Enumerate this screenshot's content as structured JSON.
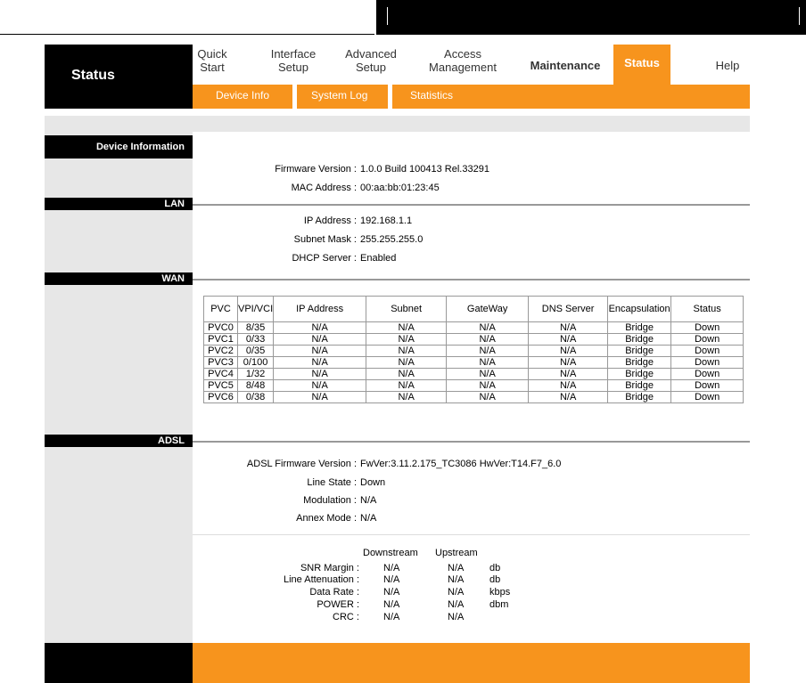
{
  "header": {
    "title": "Status",
    "nav": [
      {
        "label1": "Quick",
        "label2": "Start"
      },
      {
        "label1": "Interface",
        "label2": "Setup"
      },
      {
        "label1": "Advanced",
        "label2": "Setup"
      },
      {
        "label1": "Access",
        "label2": "Management"
      },
      {
        "label1": "Maintenance"
      },
      {
        "label1": "Status"
      },
      {
        "label1": "Help"
      }
    ],
    "subnav": [
      "Device Info",
      "System Log",
      "Statistics"
    ]
  },
  "device_info": {
    "section": "Device Information",
    "firmware_label": "Firmware Version :",
    "firmware_value": "1.0.0 Build 100413 Rel.33291",
    "mac_label": "MAC Address :",
    "mac_value": "00:aa:bb:01:23:45"
  },
  "lan": {
    "section": "LAN",
    "ip_label": "IP Address :",
    "ip_value": "192.168.1.1",
    "mask_label": "Subnet Mask :",
    "mask_value": "255.255.255.0",
    "dhcp_label": "DHCP Server :",
    "dhcp_value": "Enabled"
  },
  "wan": {
    "section": "WAN",
    "columns": [
      "PVC",
      "VPI/VCI",
      "IP Address",
      "Subnet",
      "GateWay",
      "DNS Server",
      "Encapsulation",
      "Status"
    ],
    "rows": [
      [
        "PVC0",
        "8/35",
        "N/A",
        "N/A",
        "N/A",
        "N/A",
        "Bridge",
        "Down"
      ],
      [
        "PVC1",
        "0/33",
        "N/A",
        "N/A",
        "N/A",
        "N/A",
        "Bridge",
        "Down"
      ],
      [
        "PVC2",
        "0/35",
        "N/A",
        "N/A",
        "N/A",
        "N/A",
        "Bridge",
        "Down"
      ],
      [
        "PVC3",
        "0/100",
        "N/A",
        "N/A",
        "N/A",
        "N/A",
        "Bridge",
        "Down"
      ],
      [
        "PVC4",
        "1/32",
        "N/A",
        "N/A",
        "N/A",
        "N/A",
        "Bridge",
        "Down"
      ],
      [
        "PVC5",
        "8/48",
        "N/A",
        "N/A",
        "N/A",
        "N/A",
        "Bridge",
        "Down"
      ],
      [
        "PVC6",
        "0/38",
        "N/A",
        "N/A",
        "N/A",
        "N/A",
        "Bridge",
        "Down"
      ]
    ]
  },
  "adsl": {
    "section": "ADSL",
    "fw_label": "ADSL Firmware Version :",
    "fw_value": "FwVer:3.11.2.175_TC3086 HwVer:T14.F7_6.0",
    "line_label": "Line State :",
    "line_value": "Down",
    "mod_label": "Modulation :",
    "mod_value": "N/A",
    "annex_label": "Annex Mode :",
    "annex_value": "N/A",
    "stats_head_down": "Downstream",
    "stats_head_up": "Upstream",
    "stats": [
      {
        "label": "SNR Margin :",
        "down": "N/A",
        "up": "N/A",
        "unit": "db"
      },
      {
        "label": "Line Attenuation :",
        "down": "N/A",
        "up": "N/A",
        "unit": "db"
      },
      {
        "label": "Data Rate :",
        "down": "N/A",
        "up": "N/A",
        "unit": "kbps"
      },
      {
        "label": "POWER :",
        "down": "N/A",
        "up": "N/A",
        "unit": "dbm"
      },
      {
        "label": "CRC :",
        "down": "N/A",
        "up": "N/A",
        "unit": ""
      }
    ]
  },
  "colors": {
    "accent": "#f7941d",
    "panel": "#e7e7e7",
    "dark": "#000000"
  }
}
